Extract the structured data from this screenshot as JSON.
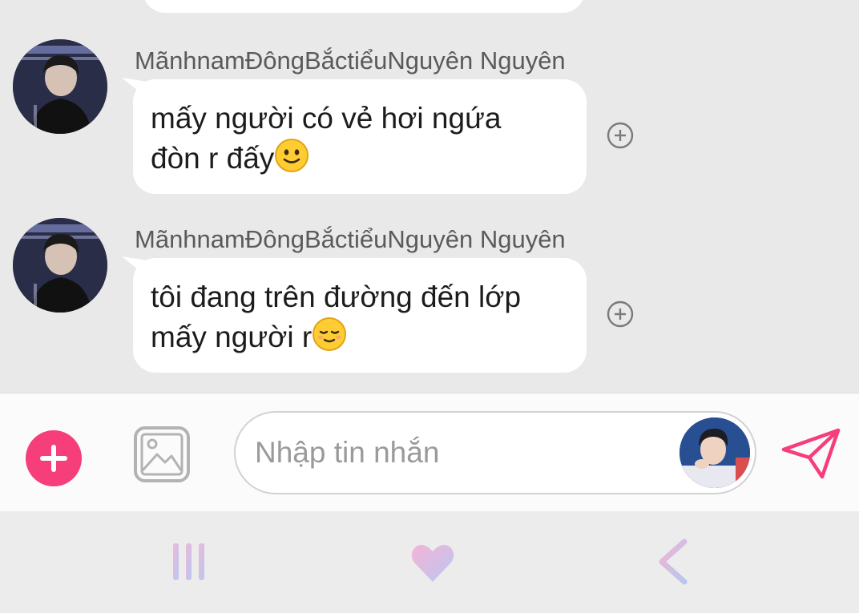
{
  "messages": [
    {
      "sender": "MãnhnamĐôngBắctiểuNguyên Nguyên",
      "line1": "mấy người có vẻ hơi ngứa",
      "line2": "đòn r đấy",
      "emoji": "slightly-smiling-face"
    },
    {
      "sender": "MãnhnamĐôngBắctiểuNguyên Nguyên",
      "line1": "tôi đang trên đường đến lớp",
      "line2": "mấy người r",
      "emoji": "relieved-face"
    }
  ],
  "composer": {
    "placeholder": "Nhập tin nhắn",
    "value": ""
  },
  "colors": {
    "accent": "#f53e7a",
    "chat_background": "#e9e9e9",
    "bubble": "#ffffff"
  }
}
